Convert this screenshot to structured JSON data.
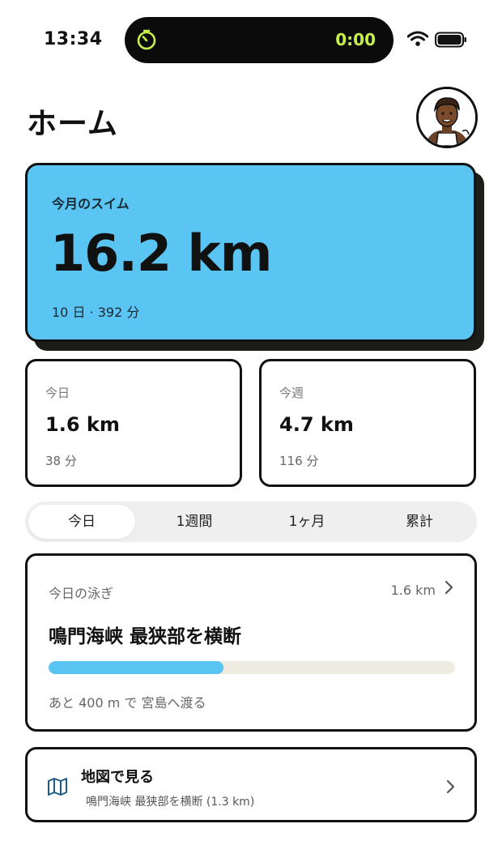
{
  "status_bar": {
    "time": "13:34",
    "timer": "0:00",
    "icons": [
      "timer-icon",
      "wifi-icon",
      "battery-icon"
    ]
  },
  "header": {
    "title": "ホーム",
    "avatar_icon": "avatar"
  },
  "month_card": {
    "label": "今月のスイム",
    "distance": "16.2 km",
    "summary": "10 日 · 392 分",
    "color": "#5ac4f2"
  },
  "today_card": {
    "label": "今日",
    "distance": "1.6 km",
    "duration": "38 分"
  },
  "week_card": {
    "label": "今週",
    "distance": "4.7 km",
    "duration": "116 分"
  },
  "segments": {
    "items": [
      "今日",
      "1週間",
      "1ヶ月",
      "累計"
    ],
    "selected": "今日"
  },
  "swim_card": {
    "label": "今日の泳ぎ",
    "distance": "1.6 km",
    "route_title": "鳴門海峡 最狭部を横断",
    "progress": 0.43,
    "note": "あと 400 m で 宮島へ渡る"
  },
  "map_button": {
    "title": "地図で見る",
    "subtitle": "鳴門海峡 最狭部を横断 (1.3 km)",
    "icon": "map-icon"
  }
}
